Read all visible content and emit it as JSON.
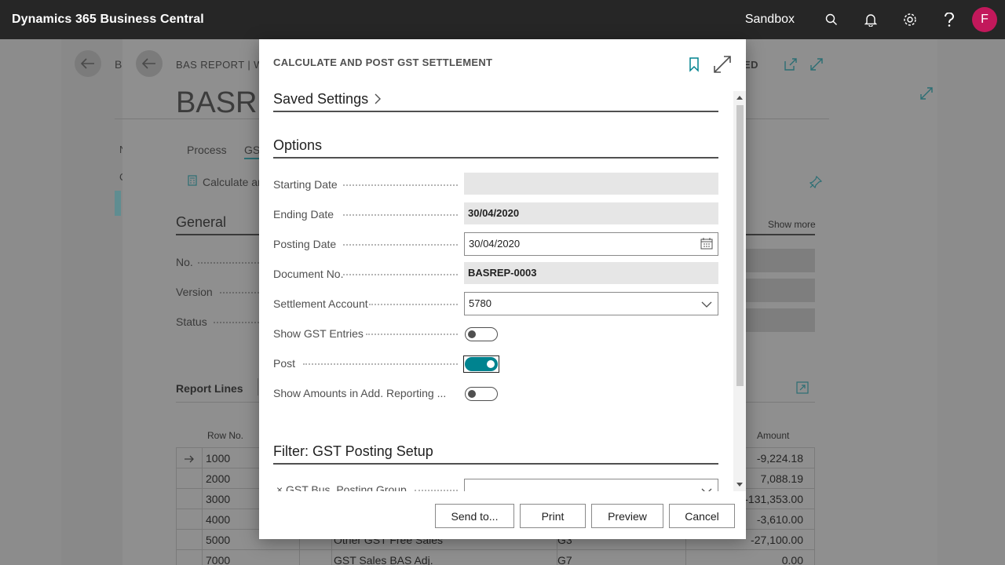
{
  "appbar": {
    "brand": "Dynamics 365 Business Central",
    "environment": "Sandbox",
    "avatar_initial": "F"
  },
  "background": {
    "layer1_header_fragment": "B",
    "page_caption": "BAS REPORT | WO",
    "page_caption_suffix": "ED",
    "page_title": "BASRE",
    "tabs": [
      "Process",
      "GS"
    ],
    "action_label": "Calculate ar",
    "side_letters": [
      "N",
      "C"
    ],
    "general_header": "General",
    "show_more": "Show more",
    "general_fields": [
      "No.",
      "Version",
      "Status"
    ],
    "lines_header": "Report Lines",
    "columns": {
      "row_no": "Row No.",
      "amount": "Amount"
    },
    "rows": [
      {
        "row": "1000",
        "desc": "",
        "field": "",
        "amount": "-9,224.18",
        "current": true
      },
      {
        "row": "2000",
        "desc": "",
        "field": "",
        "amount": "7,088.19",
        "current": false
      },
      {
        "row": "3000",
        "desc": "",
        "field": "",
        "amount": "-131,353.00",
        "current": false
      },
      {
        "row": "4000",
        "desc": "",
        "field": "",
        "amount": "-3,610.00",
        "current": false
      },
      {
        "row": "5000",
        "desc": "Other GST Free Sales",
        "field": "G3",
        "amount": "-27,100.00",
        "current": false
      },
      {
        "row": "7000",
        "desc": "GST Sales BAS Adj.",
        "field": "G7",
        "amount": "0.00",
        "current": false
      }
    ]
  },
  "dialog": {
    "title": "CALCULATE AND POST GST SETTLEMENT",
    "saved_settings": "Saved Settings",
    "options_header": "Options",
    "fields": {
      "starting_date": {
        "label": "Starting Date",
        "value": ""
      },
      "ending_date": {
        "label": "Ending Date",
        "value": "30/04/2020"
      },
      "posting_date": {
        "label": "Posting Date",
        "value": "30/04/2020"
      },
      "document_no": {
        "label": "Document No.",
        "value": "BASREP-0003"
      },
      "settlement_account": {
        "label": "Settlement Account",
        "value": "5780"
      },
      "show_gst_entries": {
        "label": "Show GST Entries",
        "on": false
      },
      "post": {
        "label": "Post",
        "on": true
      },
      "show_amounts_acy": {
        "label": "Show Amounts in Add. Reporting ...",
        "on": false
      }
    },
    "filter_header": "Filter: GST Posting Setup",
    "filter_field": {
      "remove_glyph": "×",
      "label": "GST Bus. Posting Group",
      "value": ""
    },
    "buttons": {
      "send_to": "Send to...",
      "print": "Print",
      "preview": "Preview",
      "cancel": "Cancel"
    }
  },
  "colors": {
    "appbar": "#262626",
    "accent": "#00838f",
    "avatar": "#c2185b"
  }
}
